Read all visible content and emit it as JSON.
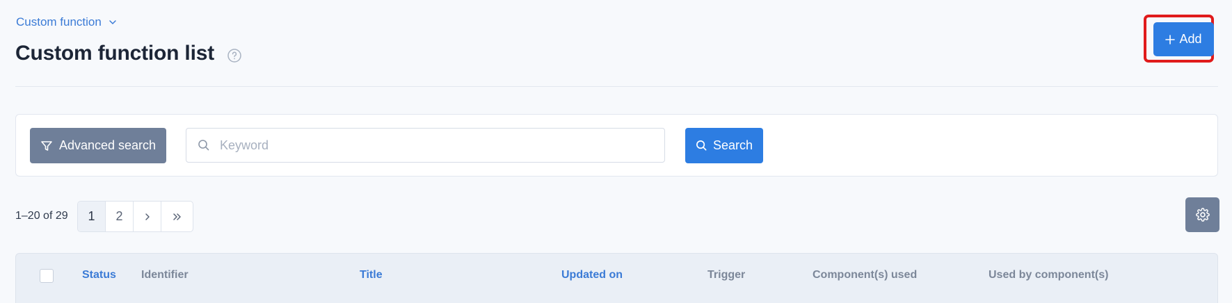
{
  "breadcrumb": {
    "label": "Custom function"
  },
  "header": {
    "title": "Custom function list",
    "add_label": "Add"
  },
  "search": {
    "advanced_label": "Advanced search",
    "keyword_placeholder": "Keyword",
    "keyword_value": "",
    "search_label": "Search"
  },
  "pagination": {
    "range": "1–20 of 29",
    "pages": [
      "1",
      "2"
    ],
    "current": "1"
  },
  "table": {
    "columns": [
      {
        "label": "Status",
        "sortable": true
      },
      {
        "label": "Identifier",
        "sortable": false
      },
      {
        "label": "Title",
        "sortable": true
      },
      {
        "label": "Updated on",
        "sortable": true
      },
      {
        "label": "Trigger",
        "sortable": false
      },
      {
        "label": "Component(s) used",
        "sortable": false
      },
      {
        "label": "Used by component(s)",
        "sortable": false
      }
    ]
  },
  "icons": {
    "breadcrumb_chevron": "chevron-down-icon",
    "help": "help-circle-icon",
    "add": "plus-icon",
    "advanced": "filter-icon",
    "keyword": "search-icon",
    "search": "search-icon",
    "next": "chevron-right-icon",
    "last": "double-chevron-right-icon",
    "settings": "gear-icon"
  },
  "colors": {
    "primary": "#2d7de2",
    "secondary": "#6f7f99",
    "highlight": "#e01b1b",
    "link": "#3b7bd6"
  }
}
